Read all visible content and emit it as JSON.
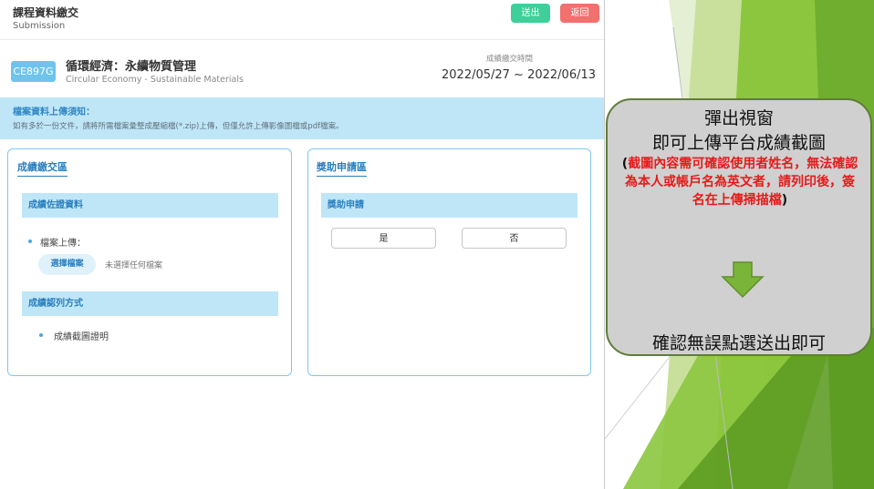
{
  "header": {
    "title": "課程資料繳交",
    "subtitle": "Submission",
    "submit_label": "送出",
    "back_label": "返回"
  },
  "course": {
    "code": "CE897G",
    "name": "循環經濟：永續物質管理",
    "name_en": "Circular Economy - Sustainable Materials",
    "period_label": "成績繳交時間",
    "period_value": "2022/05/27 ~ 2022/06/13"
  },
  "notice": {
    "title": "檔案資料上傳須知：",
    "text": "如有多於一份文件，請將所需檔案彙整成壓縮檔(*.zip)上傳，但僅允許上傳影像圖檔或pdf檔案。"
  },
  "grade_panel": {
    "title": "成績繳交區",
    "evidence_header": "成績佐證資料",
    "upload_label": "檔案上傳：",
    "choose_file_label": "選擇檔案",
    "no_file_label": "未選擇任何檔案",
    "method_header": "成績認列方式",
    "method_item": "成績截圖證明"
  },
  "scholarship_panel": {
    "title": "獎助申請區",
    "header": "獎助申請",
    "yes_label": "是",
    "no_label": "否"
  },
  "callout": {
    "line1": "彈出視窗",
    "line2": "即可上傳平台成績截圖",
    "paren_open": "(",
    "red_text": "截圖內容需可確認使用者姓名，無法確認為本人或帳戶名為英文者，請列印後，簽名在上傳掃描檔",
    "paren_close": ")",
    "line3": "確認無誤點選送出即可"
  },
  "colors": {
    "accent_blue": "#2a7fc0",
    "submit_green": "#3ecf9a",
    "back_red": "#f2706e",
    "callout_red": "#e8191a",
    "slide_green": "#8cc63f",
    "arrow_green": "#7ab53a"
  },
  "icons": {
    "down_arrow": "down-arrow-icon"
  }
}
